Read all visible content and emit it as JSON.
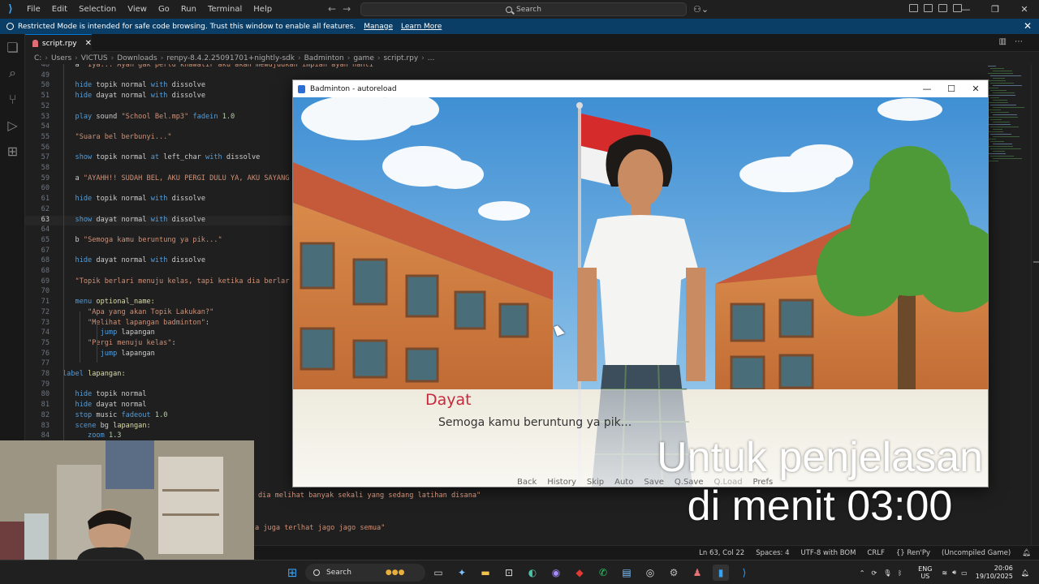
{
  "titlebar": {
    "menu": [
      "File",
      "Edit",
      "Selection",
      "View",
      "Go",
      "Run",
      "Terminal",
      "Help"
    ],
    "search_label": "Search"
  },
  "banner": {
    "message": "Restricted Mode is intended for safe code browsing. Trust this window to enable all features.",
    "manage": "Manage",
    "learn_more": "Learn More"
  },
  "tab": {
    "label": "script.rpy"
  },
  "breadcrumb": [
    "C:",
    "Users",
    "VICTUS",
    "Downloads",
    "renpy-8.4.2.25091701+nightly-sdk",
    "Badminton",
    "game",
    "script.rpy",
    "..."
  ],
  "editor": {
    "current_line": 63,
    "lines": [
      {
        "n": "48",
        "indent": 1,
        "code": "a \"Iya... Ayah gak perlu khawatir aku akan mewujudkan impian ayah nanti\""
      },
      {
        "n": "49",
        "indent": 0,
        "code": ""
      },
      {
        "n": "50",
        "indent": 1,
        "code": "hide topik normal with dissolve"
      },
      {
        "n": "51",
        "indent": 1,
        "code": "hide dayat normal with dissolve"
      },
      {
        "n": "52",
        "indent": 0,
        "code": ""
      },
      {
        "n": "53",
        "indent": 1,
        "code": "play sound \"School Bel.mp3\" fadein 1.0"
      },
      {
        "n": "54",
        "indent": 0,
        "code": ""
      },
      {
        "n": "55",
        "indent": 1,
        "code": "\"Suara bel berbunyi...\""
      },
      {
        "n": "56",
        "indent": 0,
        "code": ""
      },
      {
        "n": "57",
        "indent": 1,
        "code": "show topik normal at left_char with dissolve"
      },
      {
        "n": "58",
        "indent": 0,
        "code": ""
      },
      {
        "n": "59",
        "indent": 1,
        "code": "a \"AYAHH!! SUDAH BEL, AKU PERGI DULU YA, AKU SAYANG"
      },
      {
        "n": "60",
        "indent": 0,
        "code": ""
      },
      {
        "n": "61",
        "indent": 1,
        "code": "hide topik normal with dissolve"
      },
      {
        "n": "62",
        "indent": 0,
        "code": ""
      },
      {
        "n": "63",
        "indent": 1,
        "code": "show dayat normal with dissolve"
      },
      {
        "n": "64",
        "indent": 0,
        "code": ""
      },
      {
        "n": "65",
        "indent": 1,
        "code": "b \"Semoga kamu beruntung ya pik...\""
      },
      {
        "n": "67",
        "indent": 0,
        "code": ""
      },
      {
        "n": "68",
        "indent": 1,
        "code": "hide dayat normal with dissolve"
      },
      {
        "n": "68",
        "indent": 0,
        "code": ""
      },
      {
        "n": "69",
        "indent": 1,
        "code": "\"Topik berlari menuju kelas, tapi ketika dia berlar"
      },
      {
        "n": "70",
        "indent": 0,
        "code": ""
      },
      {
        "n": "71",
        "indent": 1,
        "code": "menu optional_name:"
      },
      {
        "n": "72",
        "indent": 2,
        "code": "\"Apa yang akan Topik Lakukan?\""
      },
      {
        "n": "73",
        "indent": 2,
        "code": "\"Melihat lapangan badminton\":"
      },
      {
        "n": "74",
        "indent": 3,
        "code": "jump lapangan"
      },
      {
        "n": "75",
        "indent": 2,
        "code": "\"Pergi menuju kelas\":"
      },
      {
        "n": "76",
        "indent": 3,
        "code": "jump lapangan"
      },
      {
        "n": "77",
        "indent": 0,
        "code": ""
      },
      {
        "n": "78",
        "indent": 0,
        "code": "label lapangan:"
      },
      {
        "n": "79",
        "indent": 0,
        "code": ""
      },
      {
        "n": "80",
        "indent": 1,
        "code": "hide topik normal"
      },
      {
        "n": "81",
        "indent": 1,
        "code": "hide dayat normal"
      },
      {
        "n": "82",
        "indent": 1,
        "code": "stop music fadeout 1.0"
      },
      {
        "n": "83",
        "indent": 1,
        "code": "scene bg lapangan:"
      },
      {
        "n": "84",
        "indent": 2,
        "code": "zoom 1.3"
      }
    ],
    "hidden_lines": [
      {
        "code": "dia melihat banyak sekali yang sedang latihan disana\""
      },
      {
        "code": "a juga terlhat jago jago semua\""
      }
    ]
  },
  "statusbar": {
    "items": [
      "Ln 63, Col 22",
      "Spaces: 4",
      "UTF-8 with BOM",
      "CRLF",
      "{} Ren'Py",
      "(Uncompiled Game)"
    ]
  },
  "taskbar": {
    "search_label": "Search",
    "lang_top": "ENG",
    "lang_bottom": "US",
    "time": "20:06",
    "date": "19/10/2025"
  },
  "game": {
    "window_title": "Badminton - autoreload",
    "speaker": "Dayat",
    "dialogue": "Semoga kamu beruntung ya pik...",
    "quick_menu": [
      "Back",
      "History",
      "Skip",
      "Auto",
      "Save",
      "Q.Save",
      "Q.Load",
      "Prefs"
    ],
    "speaker_color": "#c8283c"
  },
  "overlay": {
    "line1": "Untuk penjelasan",
    "line2": "di menit 03:00"
  },
  "colors": {
    "accent": "#0078d4",
    "banner": "#0b3e66"
  }
}
